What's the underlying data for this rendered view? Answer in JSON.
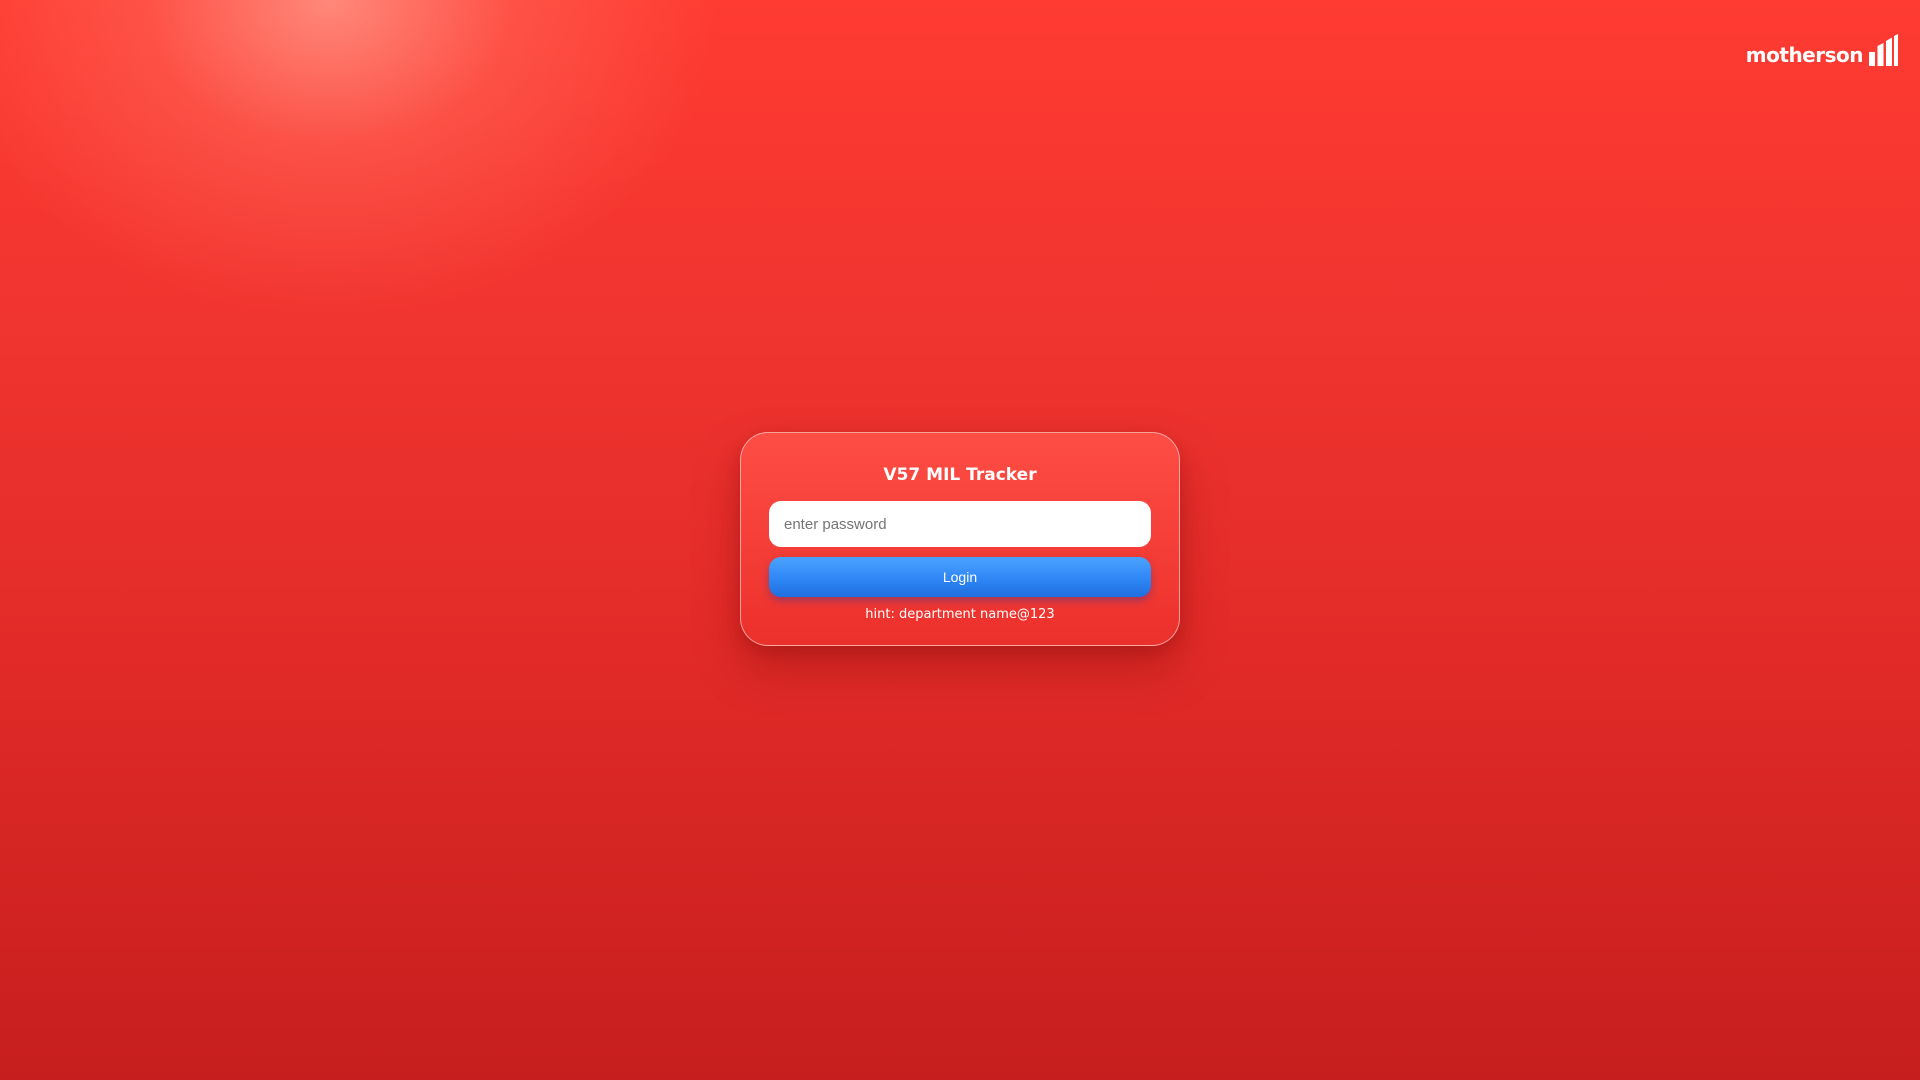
{
  "brand": {
    "name": "motherson",
    "icon": "motherson-bars-logo",
    "color": "#ffffff"
  },
  "login": {
    "title": "V57 MIL Tracker",
    "password_placeholder": "enter password",
    "password_value": "",
    "button_label": "Login",
    "hint": "hint: department name@123"
  },
  "colors": {
    "background_top": "#ff3b32",
    "background_bottom": "#c61e1e",
    "card": "#ef3a35",
    "button": "#2f86f5",
    "text": "#ffffff"
  }
}
